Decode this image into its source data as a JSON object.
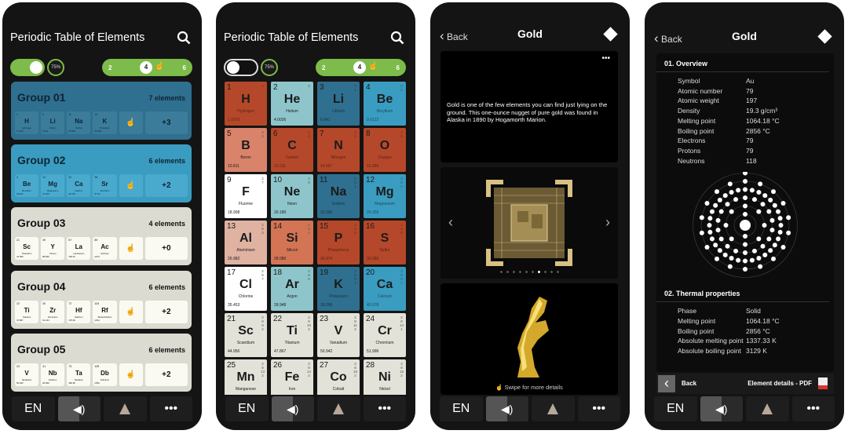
{
  "app_title": "Periodic Table of Elements",
  "controls": {
    "percent": "75%",
    "slider_min": "2",
    "slider_value": "4",
    "slider_max": "6",
    "toggle_on": true
  },
  "bottom_bar": {
    "language": "EN",
    "icons": [
      "speaker-icon",
      "flask-icon",
      "more-icon"
    ],
    "more": "•••"
  },
  "colors": {
    "accent": "#7dbb4a",
    "nonmetal": "#b5482a",
    "noble": "#8ec5cb",
    "alkali": "#2f6f8f",
    "alkaline": "#3a9cc0",
    "metalloid": "#d8836a",
    "metalloid2": "#d37455",
    "post": "#e0b2a2",
    "halogen": "#ffffff",
    "transition": "#e3e2d9"
  },
  "groups": [
    {
      "name": "Group 01",
      "count": "7 elements",
      "more": "+3",
      "bg": "#2f6f8f",
      "cell": "#3b7c9b",
      "fg": "#0f2433",
      "elements": [
        {
          "n": "1",
          "s": "H",
          "nm": "Hydrogen",
          "w": "1.0079"
        },
        {
          "n": "3",
          "s": "Li",
          "nm": "Lithium",
          "w": "6.941"
        },
        {
          "n": "11",
          "s": "Na",
          "nm": "Sodium",
          "w": "22.990"
        },
        {
          "n": "19",
          "s": "K",
          "nm": "Potassium",
          "w": "39.098"
        }
      ]
    },
    {
      "name": "Group 02",
      "count": "6 elements",
      "more": "+2",
      "bg": "#3a9cc0",
      "cell": "#4aaace",
      "fg": "#0f2433",
      "elements": [
        {
          "n": "4",
          "s": "Be",
          "nm": "Beryllium",
          "w": "9.0122"
        },
        {
          "n": "12",
          "s": "Mg",
          "nm": "Magnesium",
          "w": "24.305"
        },
        {
          "n": "20",
          "s": "Ca",
          "nm": "Calcium",
          "w": "40.078"
        },
        {
          "n": "38",
          "s": "Sr",
          "nm": "Strontium",
          "w": "87.62"
        }
      ]
    },
    {
      "name": "Group 03",
      "count": "4 elements",
      "more": "+0",
      "bg": "#dcdbd2",
      "cell": "#fbfaf2",
      "fg": "#111",
      "elements": [
        {
          "n": "21",
          "s": "Sc",
          "nm": "Scandium",
          "w": "44.956"
        },
        {
          "n": "39",
          "s": "Y",
          "nm": "Yttrium",
          "w": "88.906"
        },
        {
          "n": "57",
          "s": "La",
          "nm": "Lanthanum",
          "w": "138.91"
        },
        {
          "n": "89",
          "s": "Ac",
          "nm": "Actinium",
          "w": "(227)"
        }
      ]
    },
    {
      "name": "Group 04",
      "count": "6 elements",
      "more": "+2",
      "bg": "#dcdbd2",
      "cell": "#fbfaf2",
      "fg": "#111",
      "elements": [
        {
          "n": "22",
          "s": "Ti",
          "nm": "Titanium",
          "w": "47.867"
        },
        {
          "n": "40",
          "s": "Zr",
          "nm": "Zirconium",
          "w": "91.224"
        },
        {
          "n": "72",
          "s": "Hf",
          "nm": "Hafnium",
          "w": "178.49"
        },
        {
          "n": "104",
          "s": "Rf",
          "nm": "Rutherfordium",
          "w": "(261)"
        }
      ]
    },
    {
      "name": "Group 05",
      "count": "6 elements",
      "more": "+2",
      "bg": "#dcdbd2",
      "cell": "#fbfaf2",
      "fg": "#111",
      "elements": [
        {
          "n": "23",
          "s": "V",
          "nm": "Vanadium",
          "w": "50.942"
        },
        {
          "n": "41",
          "s": "Nb",
          "nm": "Niobium",
          "w": "92.906"
        },
        {
          "n": "73",
          "s": "Ta",
          "nm": "Tantalum",
          "w": "180.95"
        },
        {
          "n": "105",
          "s": "Db",
          "nm": "Dubnium",
          "w": "(262)"
        }
      ]
    }
  ],
  "elements": [
    {
      "n": "1",
      "s": "H",
      "nm": "Hydrogen",
      "w": "1.0079",
      "sh": "1",
      "c": "nonmetal"
    },
    {
      "n": "2",
      "s": "He",
      "nm": "Helium",
      "w": "4.0026",
      "sh": "2",
      "c": "noble"
    },
    {
      "n": "3",
      "s": "Li",
      "nm": "Lithium",
      "w": "6.941",
      "sh": "2 1",
      "c": "alkali"
    },
    {
      "n": "4",
      "s": "Be",
      "nm": "Beryllium",
      "w": "9.0122",
      "sh": "2 2",
      "c": "alkaline"
    },
    {
      "n": "5",
      "s": "B",
      "nm": "Boron",
      "w": "10.811",
      "sh": "2 3",
      "c": "metalloid"
    },
    {
      "n": "6",
      "s": "C",
      "nm": "Carbon",
      "w": "12.011",
      "sh": "2 4",
      "c": "nonmetal"
    },
    {
      "n": "7",
      "s": "N",
      "nm": "Nitrogen",
      "w": "14.007",
      "sh": "2 5",
      "c": "nonmetal"
    },
    {
      "n": "8",
      "s": "O",
      "nm": "Oxygen",
      "w": "15.999",
      "sh": "2 6",
      "c": "nonmetal"
    },
    {
      "n": "9",
      "s": "F",
      "nm": "Fluorine",
      "w": "18.998",
      "sh": "2 7",
      "c": "halogen"
    },
    {
      "n": "10",
      "s": "Ne",
      "nm": "Neon",
      "w": "20.180",
      "sh": "2 8",
      "c": "noble"
    },
    {
      "n": "11",
      "s": "Na",
      "nm": "Sodium",
      "w": "22.990",
      "sh": "2 8 1",
      "c": "alkali"
    },
    {
      "n": "12",
      "s": "Mg",
      "nm": "Magnesium",
      "w": "24.305",
      "sh": "2 8 2",
      "c": "alkaline"
    },
    {
      "n": "13",
      "s": "Al",
      "nm": "Aluminium",
      "w": "26.982",
      "sh": "2 8 3",
      "c": "post"
    },
    {
      "n": "14",
      "s": "Si",
      "nm": "Silicon",
      "w": "28.086",
      "sh": "2 8 4",
      "c": "metalloid2"
    },
    {
      "n": "15",
      "s": "P",
      "nm": "Phosphorus",
      "w": "30.974",
      "sh": "2 8 5",
      "c": "nonmetal"
    },
    {
      "n": "16",
      "s": "S",
      "nm": "Sulfur",
      "w": "32.065",
      "sh": "2 8 6",
      "c": "nonmetal"
    },
    {
      "n": "17",
      "s": "Cl",
      "nm": "Chlorine",
      "w": "35.453",
      "sh": "2 8 7",
      "c": "halogen"
    },
    {
      "n": "18",
      "s": "Ar",
      "nm": "Argon",
      "w": "39.948",
      "sh": "2 8 8",
      "c": "noble"
    },
    {
      "n": "19",
      "s": "K",
      "nm": "Potassium",
      "w": "39.098",
      "sh": "2 8 8 1",
      "c": "alkali"
    },
    {
      "n": "20",
      "s": "Ca",
      "nm": "Calcium",
      "w": "40.078",
      "sh": "2 8 8 2",
      "c": "alkaline"
    },
    {
      "n": "21",
      "s": "Sc",
      "nm": "Scandium",
      "w": "44.956",
      "sh": "2 8 9 2",
      "c": "transition"
    },
    {
      "n": "22",
      "s": "Ti",
      "nm": "Titanium",
      "w": "47.867",
      "sh": "2 8 10 2",
      "c": "transition"
    },
    {
      "n": "23",
      "s": "V",
      "nm": "Vanadium",
      "w": "50.942",
      "sh": "2 8 11 2",
      "c": "transition"
    },
    {
      "n": "24",
      "s": "Cr",
      "nm": "Chromium",
      "w": "51.996",
      "sh": "2 8 13 1",
      "c": "transition"
    },
    {
      "n": "25",
      "s": "Mn",
      "nm": "Manganese",
      "sh": "2 8 13 2",
      "c": "transition"
    },
    {
      "n": "26",
      "s": "Fe",
      "nm": "Iron",
      "sh": "2 8 14 2",
      "c": "transition"
    },
    {
      "n": "27",
      "s": "Co",
      "nm": "Cobalt",
      "sh": "2 8 15 2",
      "c": "transition"
    },
    {
      "n": "28",
      "s": "Ni",
      "nm": "Nickel",
      "sh": "2 8 16 2",
      "c": "transition"
    }
  ],
  "detail": {
    "back": "Back",
    "title": "Gold",
    "more": "•••",
    "fact": "Gold is one of the few elements you can find just lying on the ground. This one-ounce nugget of pure gold was found in Alaska in 1890 by Hogamorth Marion.",
    "carousel_pages": 10,
    "carousel_active": 6,
    "swipe_hint": "Swipe for more details",
    "overview_title": "01. Overview",
    "overview": [
      [
        "Symbol",
        "Au"
      ],
      [
        "Atomic number",
        "79"
      ],
      [
        "Atomic weight",
        "197"
      ],
      [
        "Density",
        "19.3 g/cm³"
      ],
      [
        "Melting point",
        "1064.18 °C"
      ],
      [
        "Boiling point",
        "2856 °C"
      ],
      [
        "Electrons",
        "79"
      ],
      [
        "Protons",
        "79"
      ],
      [
        "Neutrons",
        "118"
      ]
    ],
    "shells": [
      2,
      8,
      18,
      32,
      18,
      1
    ],
    "thermal_title": "02. Thermal properties",
    "thermal": [
      [
        "Phase",
        "Solid"
      ],
      [
        "Melting point",
        "1064.18 °C"
      ],
      [
        "Boiling point",
        "2856 °C"
      ],
      [
        "Absolute melting point",
        "1337.33 K"
      ],
      [
        "Absolute boiling point",
        "3129 K"
      ]
    ],
    "footer_back": "Back",
    "pdf_label": "Element details - PDF"
  }
}
